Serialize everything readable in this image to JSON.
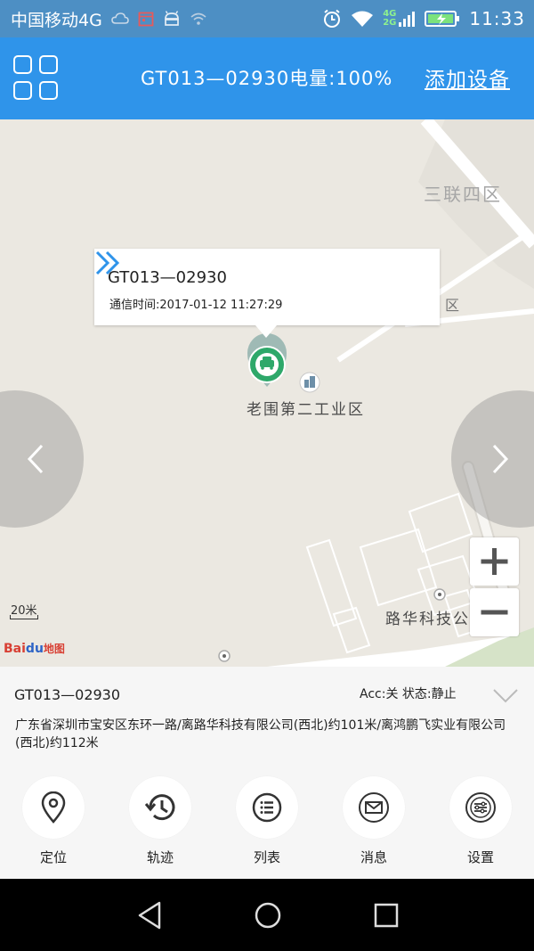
{
  "status_bar": {
    "carrier": "中国移动4G",
    "net_badges": [
      "4G",
      "2G"
    ],
    "time": "11:33"
  },
  "header": {
    "device_title": "GT013—02930电量:100%",
    "add_device": "添加设备",
    "menu_icon": "grid-icon",
    "color": "#2f94ea"
  },
  "map": {
    "popup": {
      "name": "GT013—02930",
      "time": "通信时间:2017-01-12 11:27:29"
    },
    "labels": {
      "district": "三联四区",
      "popup_partial": "区",
      "industrial_zone": "老围第二工业区",
      "road": "路华科技公"
    },
    "scale": "20米",
    "logo": {
      "bai": "Bai",
      "du": "du",
      "ditu": "地图"
    }
  },
  "info": {
    "name": "GT013—02930",
    "status": "Acc:关 状态:静止",
    "address": "广东省深圳市宝安区东环一路/离路华科技有限公司(西北)约101米/离鸿鹏飞实业有限公司(西北)约112米"
  },
  "toolbar": [
    {
      "label": "定位",
      "icon": "location-pin-icon"
    },
    {
      "label": "轨迹",
      "icon": "history-icon"
    },
    {
      "label": "列表",
      "icon": "list-icon"
    },
    {
      "label": "消息",
      "icon": "message-icon"
    },
    {
      "label": "设置",
      "icon": "settings-icon"
    }
  ]
}
